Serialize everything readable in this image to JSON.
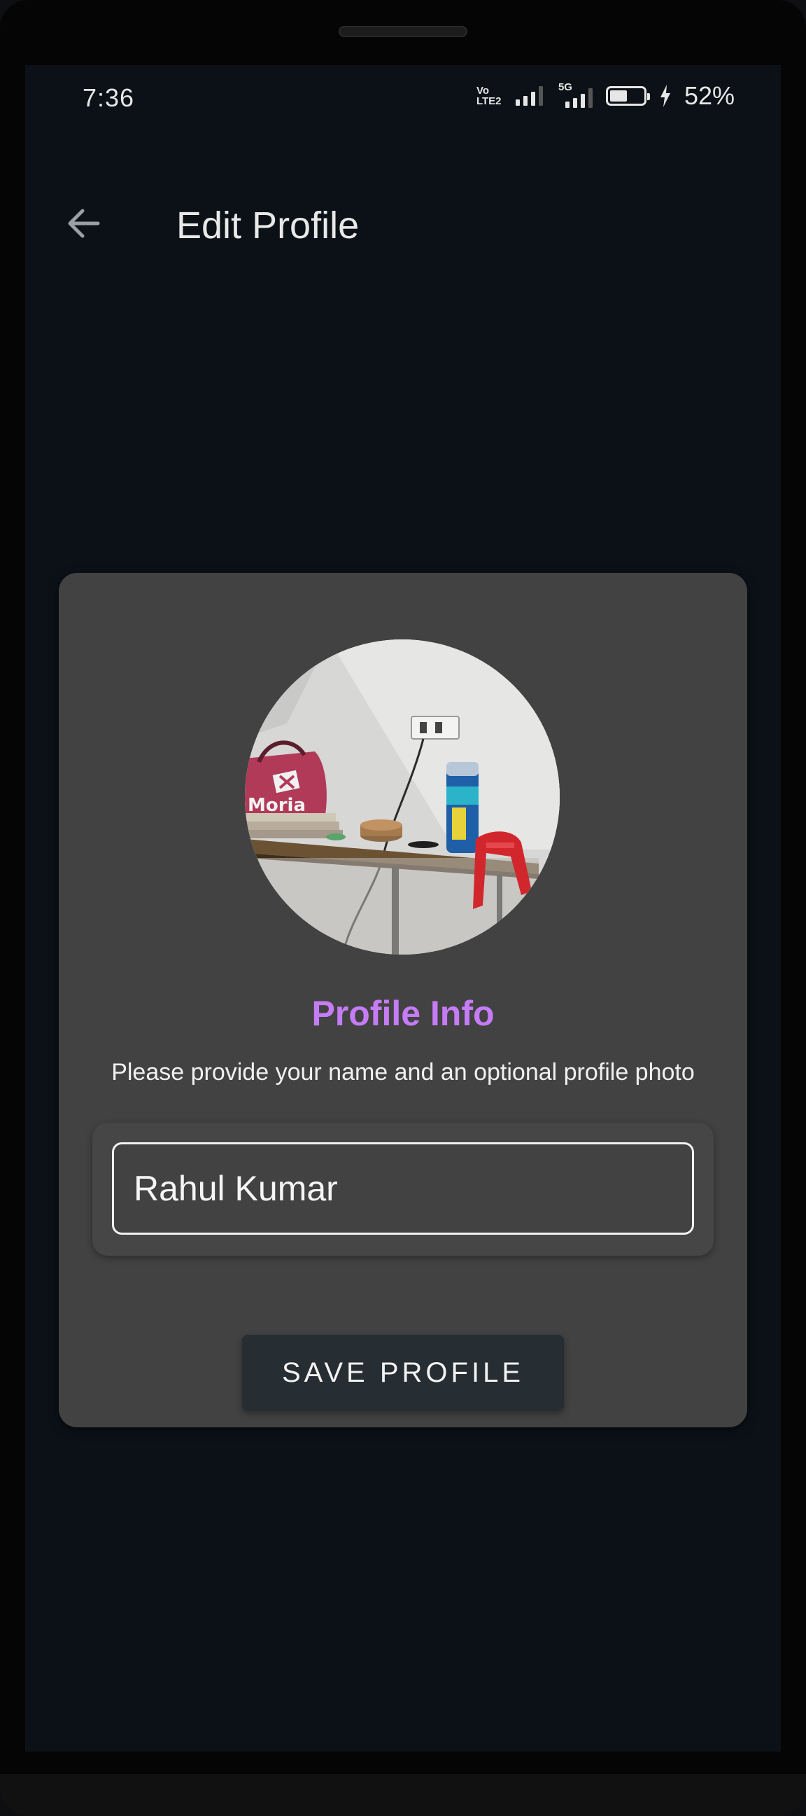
{
  "status_bar": {
    "time": "7:36",
    "volte_label": "Vo LTE2",
    "network_label": "5G",
    "battery_percent_text": "52%",
    "battery_level": 0.52,
    "icons": [
      "volte-icon",
      "signal-icon",
      "5g-signal-icon",
      "battery-icon",
      "charging-bolt-icon"
    ]
  },
  "app_bar": {
    "back_icon": "arrow-left-icon",
    "title": "Edit Profile"
  },
  "profile_card": {
    "avatar_icon": "profile-photo",
    "title": "Profile Info",
    "subtitle": "Please provide your name and an optional profile photo",
    "name_input": {
      "value": "Rahul Kumar",
      "placeholder": ""
    },
    "save_label": "SAVE PROFILE"
  },
  "colors": {
    "background": "#0b1117",
    "card": "#424242",
    "accent": "#c57cf6",
    "button": "#262d33",
    "text": "#e8e8e8"
  }
}
